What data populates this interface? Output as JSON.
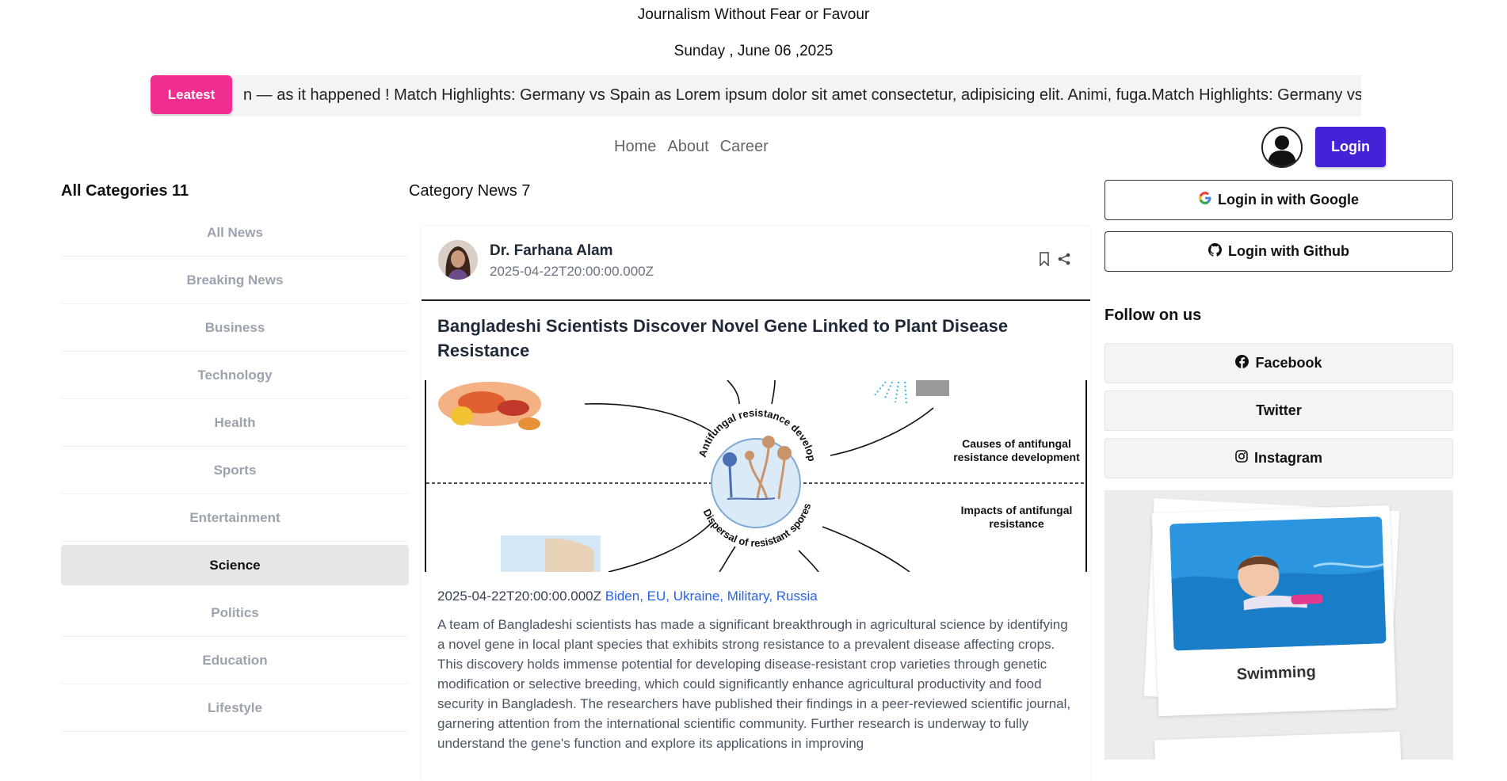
{
  "header": {
    "tagline": "Journalism Without Fear or Favour",
    "date": "Sunday , June 06 ,2025"
  },
  "ticker": {
    "label": "Leatest",
    "text": "n — as it happened ! Match Highlights: Germany vs Spain as Lorem ipsum dolor sit amet consectetur, adipisicing elit. Animi, fuga.Match Highlights: Germany vs"
  },
  "nav": {
    "items": [
      "Home",
      "About",
      "Career"
    ]
  },
  "auth": {
    "login_label": "Login",
    "google_label": "Login in with Google",
    "github_label": "Login with Github"
  },
  "categories": {
    "title": "All Categories 11",
    "items": [
      "All News",
      "Breaking News",
      "Business",
      "Technology",
      "Health",
      "Sports",
      "Entertainment",
      "Science",
      "Politics",
      "Education",
      "Lifestyle"
    ],
    "active": "Science"
  },
  "main": {
    "title": "Category News 7",
    "article": {
      "author": "Dr. Farhana Alam",
      "published": "2025-04-22T20:00:00.000Z",
      "headline": "Bangladeshi Scientists Discover Novel Gene Linked to Plant Disease Resistance",
      "figure": {
        "arc_top": "Antifungal resistance development",
        "arc_bottom": "Dispersal of resistant spores",
        "label_causes": "Causes of antifungal resistance development",
        "label_impacts": "Impacts of antifungal resistance"
      },
      "meta_date": "2025-04-22T20:00:00.000Z",
      "tags": "Biden, EU, Ukraine, Military, Russia",
      "body": "A team of Bangladeshi scientists has made a significant breakthrough in agricultural science by identifying a novel gene in local plant species that exhibits strong resistance to a prevalent disease affecting crops. This discovery holds immense potential for developing disease-resistant crop varieties through genetic modification or selective breeding, which could significantly enhance agricultural productivity and food security in Bangladesh. The researchers have published their findings in a peer-reviewed scientific journal, garnering attention from the international scientific community. Further research is underway to fully understand the gene's function and explore its applications in improving"
    }
  },
  "follow": {
    "title": "Follow on us",
    "items": [
      {
        "label": "Facebook",
        "icon": "facebook-icon"
      },
      {
        "label": "Twitter",
        "icon": ""
      },
      {
        "label": "Instagram",
        "icon": "instagram-icon"
      }
    ]
  },
  "promo": {
    "label": "Swimming"
  },
  "colors": {
    "accent_pink": "#f02e8f",
    "login_purple": "#4322d8",
    "link_blue": "#2563eb"
  }
}
